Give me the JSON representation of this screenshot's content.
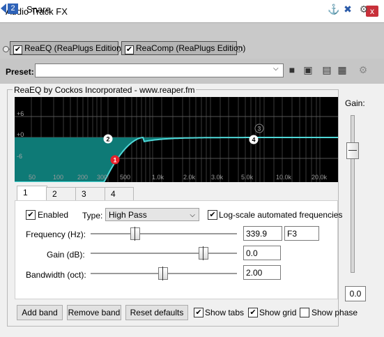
{
  "window": {
    "title": "Audio Track FX",
    "close_glyph": "x"
  },
  "track": {
    "number": "2",
    "name": "Snare"
  },
  "fx_chain": [
    {
      "label": "ReaEQ (ReaPlugs Edition)",
      "enabled": true
    },
    {
      "label": "ReaComp (ReaPlugs Edition)",
      "enabled": true
    }
  ],
  "preset": {
    "label": "Preset:",
    "value": ""
  },
  "plugin": {
    "title": "ReaEQ by Cockos Incorporated - www.reaper.fm",
    "graph": {
      "db_labels": [
        "+6",
        "+0",
        "-6"
      ],
      "freq_labels": [
        "50",
        "100",
        "200",
        "300",
        "500",
        "1.0k",
        "2.0k",
        "3.0k",
        "5.0k",
        "10.0k",
        "20.0k"
      ],
      "band_markers": [
        {
          "label": "1",
          "selected": true,
          "color": "#e8202a"
        },
        {
          "label": "2",
          "selected": false,
          "color": "#ffffff"
        },
        {
          "label": "3",
          "selected": false,
          "color": "#000000"
        },
        {
          "label": "4",
          "selected": false,
          "color": "#ffffff"
        }
      ],
      "curve_color": "#0e7a76",
      "line_color": "#4fd8d8"
    },
    "tabs": [
      "1",
      "2",
      "3",
      "4"
    ],
    "active_tab": "1",
    "band": {
      "enabled_label": "Enabled",
      "enabled": true,
      "type_label": "Type:",
      "type_value": "High Pass",
      "logscale_label": "Log-scale automated frequencies",
      "logscale": true,
      "frequency_label": "Frequency (Hz):",
      "frequency_value": "339.9",
      "frequency_note": "F3",
      "gain_label": "Gain (dB):",
      "gain_value": "0.0",
      "bandwidth_label": "Bandwidth (oct):",
      "bandwidth_value": "2.00"
    },
    "buttons": {
      "add": "Add band",
      "remove": "Remove band",
      "reset": "Reset defaults"
    },
    "options": {
      "show_tabs_label": "Show tabs",
      "show_tabs": true,
      "show_grid_label": "Show grid",
      "show_grid": true,
      "show_phase_label": "Show phase",
      "show_phase": false
    },
    "gain": {
      "label": "Gain:",
      "value": "0.0"
    }
  }
}
